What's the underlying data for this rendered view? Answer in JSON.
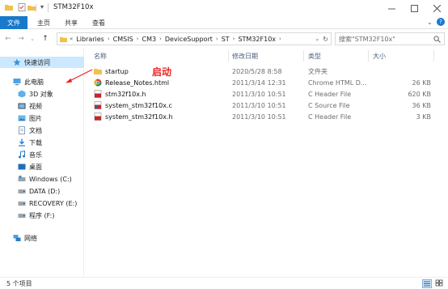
{
  "window": {
    "title": "STM32F10x"
  },
  "ribbon": {
    "tabs": [
      "文件",
      "主页",
      "共享",
      "查看"
    ]
  },
  "address": {
    "crumbs": [
      "Libraries",
      "CMSIS",
      "CM3",
      "DeviceSupport",
      "ST",
      "STM32F10x"
    ],
    "search_placeholder": "搜索\"STM32F10x\""
  },
  "sidebar": {
    "quick_access": "快速访问",
    "this_pc": "此电脑",
    "items": [
      "3D 对象",
      "视频",
      "图片",
      "文档",
      "下载",
      "音乐",
      "桌面",
      "Windows (C:)",
      "DATA (D:)",
      "RECOVERY (E:)",
      "程序 (F:)"
    ],
    "network": "网络"
  },
  "columns": {
    "name": "名称",
    "date": "修改日期",
    "type": "类型",
    "size": "大小"
  },
  "files": [
    {
      "name": "startup",
      "date": "2020/5/28 8:58",
      "type": "文件夹",
      "size": "",
      "icon": "folder-icon"
    },
    {
      "name": "Release_Notes.html",
      "date": "2011/3/14 12:31",
      "type": "Chrome HTML D...",
      "size": "26 KB",
      "icon": "chrome-icon"
    },
    {
      "name": "stm32f10x.h",
      "date": "2011/3/10 10:51",
      "type": "C Header File",
      "size": "620 KB",
      "icon": "header-file-icon"
    },
    {
      "name": "system_stm32f10x.c",
      "date": "2011/3/10 10:51",
      "type": "C Source File",
      "size": "36 KB",
      "icon": "source-file-icon"
    },
    {
      "name": "system_stm32f10x.h",
      "date": "2011/3/10 10:51",
      "type": "C Header File",
      "size": "3 KB",
      "icon": "header-file-icon"
    }
  ],
  "annotation": {
    "text": "启动"
  },
  "status": {
    "text": "5 个项目"
  },
  "colors": {
    "accent": "#1979ca",
    "annotation": "#ee2222",
    "folder": "#f0c14b"
  }
}
